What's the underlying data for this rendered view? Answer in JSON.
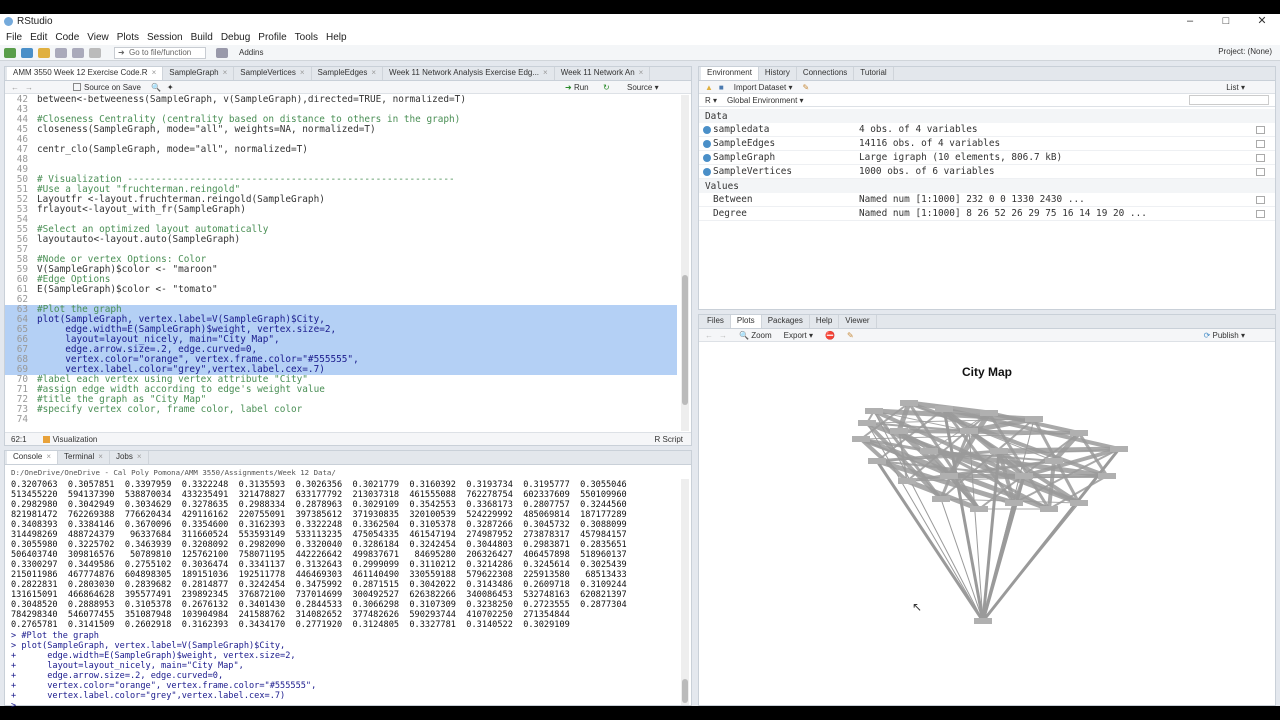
{
  "app": {
    "title": "RStudio"
  },
  "menu": [
    "File",
    "Edit",
    "Code",
    "View",
    "Plots",
    "Session",
    "Build",
    "Debug",
    "Profile",
    "Tools",
    "Help"
  ],
  "toolbar": {
    "go_to_file": "Go to file/function",
    "addins": "Addins",
    "project": "Project: (None)"
  },
  "editor": {
    "tabs": [
      "AMM 3550 Week 12 Exercise Code.R",
      "SampleGraph",
      "SampleVertices",
      "SampleEdges",
      "Week 11 Network Analysis Exercise Edg...",
      "Week 11 Network An"
    ],
    "source_on_save": "Source on Save",
    "run": "Run",
    "source": "Source",
    "lines": [
      {
        "n": "42",
        "t": "between<-betweeness(SampleGraph, v(SampleGraph),directed=TRUE, normalized=T)",
        "k": "c0"
      },
      {
        "n": "43",
        "t": "",
        "k": ""
      },
      {
        "n": "44",
        "t": "#Closeness Centrality (centrality based on distance to others in the graph)",
        "k": "c"
      },
      {
        "n": "45",
        "t": "closeness(SampleGraph, mode=\"all\", weights=NA, normalized=T)",
        "k": ""
      },
      {
        "n": "46",
        "t": "",
        "k": ""
      },
      {
        "n": "47",
        "t": "centr_clo(SampleGraph, mode=\"all\", normalized=T)",
        "k": ""
      },
      {
        "n": "48",
        "t": "",
        "k": ""
      },
      {
        "n": "49",
        "t": "",
        "k": ""
      },
      {
        "n": "50",
        "t": "# Visualization ----------------------------------------------------------",
        "k": "c"
      },
      {
        "n": "51",
        "t": "#Use a layout \"fruchterman.reingold\"",
        "k": "c"
      },
      {
        "n": "52",
        "t": "Layoutfr <-layout.fruchterman.reingold(SampleGraph)",
        "k": ""
      },
      {
        "n": "53",
        "t": "frlayout<-layout_with_fr(SampleGraph)",
        "k": ""
      },
      {
        "n": "54",
        "t": "",
        "k": ""
      },
      {
        "n": "55",
        "t": "#Select an optimized layout automatically",
        "k": "c"
      },
      {
        "n": "56",
        "t": "layoutauto<-layout.auto(SampleGraph)",
        "k": ""
      },
      {
        "n": "57",
        "t": "",
        "k": ""
      },
      {
        "n": "58",
        "t": "#Node or vertex Options: Color",
        "k": "c"
      },
      {
        "n": "59",
        "t": "V(SampleGraph)$color <- \"maroon\"",
        "k": ""
      },
      {
        "n": "60",
        "t": "#Edge Options",
        "k": "c"
      },
      {
        "n": "61",
        "t": "E(SampleGraph)$color <- \"tomato\"",
        "k": ""
      },
      {
        "n": "62",
        "t": "",
        "k": ""
      },
      {
        "n": "63",
        "t": "#Plot the graph",
        "k": "cs"
      },
      {
        "n": "64",
        "t": "plot(SampleGraph, vertex.label=V(SampleGraph)$City,",
        "k": "s"
      },
      {
        "n": "65",
        "t": "     edge.width=E(SampleGraph)$weight, vertex.size=2,",
        "k": "s"
      },
      {
        "n": "66",
        "t": "     layout=layout_nicely, main=\"City Map\",",
        "k": "s"
      },
      {
        "n": "67",
        "t": "     edge.arrow.size=.2, edge.curved=0,",
        "k": "s"
      },
      {
        "n": "68",
        "t": "     vertex.color=\"orange\", vertex.frame.color=\"#555555\",",
        "k": "s"
      },
      {
        "n": "69",
        "t": "     vertex.label.color=\"grey\",vertex.label.cex=.7)",
        "k": "s"
      },
      {
        "n": "70",
        "t": "#label each vertex using vertex attribute \"City\"",
        "k": "c"
      },
      {
        "n": "71",
        "t": "#assign edge width according to edge's weight value",
        "k": "c"
      },
      {
        "n": "72",
        "t": "#title the graph as \"City Map\"",
        "k": "c"
      },
      {
        "n": "73",
        "t": "#specify vertex color, frame color, label color",
        "k": "c"
      },
      {
        "n": "74",
        "t": "",
        "k": ""
      }
    ],
    "status_pos": "62:1",
    "status_section": "Visualization",
    "status_type": "R Script"
  },
  "env": {
    "tabs": [
      "Environment",
      "History",
      "Connections",
      "Tutorial"
    ],
    "import": "Import Dataset",
    "list": "List",
    "r": "R",
    "global": "Global Environment",
    "data_header": "Data",
    "values_header": "Values",
    "data": [
      {
        "name": "sampledata",
        "value": "4 obs. of 4 variables"
      },
      {
        "name": "SampleEdges",
        "value": "14116 obs. of 4 variables"
      },
      {
        "name": "SampleGraph",
        "value": "Large igraph (10 elements,  806.7 kB)"
      },
      {
        "name": "SampleVertices",
        "value": "1000 obs. of 6 variables"
      }
    ],
    "values": [
      {
        "name": "Between",
        "value": "Named num [1:1000] 232 0 0 1330 2430 ..."
      },
      {
        "name": "Degree",
        "value": "Named num [1:1000] 8 26 52 26 29 75 16 14 19 20 ..."
      }
    ]
  },
  "plots": {
    "tabs": [
      "Files",
      "Plots",
      "Packages",
      "Help",
      "Viewer"
    ],
    "zoom": "Zoom",
    "export": "Export",
    "publish": "Publish",
    "title": "City Map"
  },
  "console": {
    "tabs": [
      "Console",
      "Terminal",
      "Jobs"
    ],
    "path": "D:/OneDrive/OneDrive - Cal Poly Pomona/AMM 3550/Assignments/Week 12 Data/",
    "output": [
      "0.3207063  0.3057851  0.3397959  0.3322248  0.3135593  0.3026356  0.3021779  0.3160392  0.3193734  0.3195777  0.3055046",
      "513455220  594137390  538870034  433235491  321478827  633177792  213037318  461555088  762278754  602337609  550109960",
      "0.2982980  0.3042949  0.3034629  0.3278635  0.2988334  0.2878963  0.3029109  0.3542553  0.3368173  0.2807757  0.3244560",
      "821981472  762269388  776620434  429116162  220755091  397385612  371930835  320100539  524229992  485069814  187177289",
      "0.3408393  0.3384146  0.3670096  0.3354600  0.3162393  0.3322248  0.3362504  0.3105378  0.3287266  0.3045732  0.3088099",
      "314498269  488724379   96337684  311660524  553593149  533113235  475054335  461547194  274987952  273878317  457984157",
      "0.3055980  0.3225702  0.3463939  0.3208092  0.2982090  0.3320040  0.3286184  0.3242454  0.3044803  0.2983871  0.2835651",
      "506403740  309816576   50789810  125762100  758071195  442226642  499837671   84695280  206326427  406457898  518960137",
      "0.3300297  0.3449586  0.2755102  0.3036474  0.3341137  0.3132643  0.2999099  0.3110212  0.3214286  0.3245614  0.3025439",
      "215011986  467774876  604898305  189151036  192511778  446469303  461140490  330559188  579622308  225913580   68513433",
      "0.2822831  0.2803030  0.2839682  0.2814877  0.3242454  0.3475992  0.2871515  0.3042022  0.3143486  0.2609718  0.3109244",
      "131615091  466864628  395577491  239892345  376872100  737014699  300492527  626382266  340086453  532748163  620821397",
      "0.3048520  0.2888953  0.3105378  0.2676132  0.3401430  0.2844533  0.3066298  0.3107309  0.3238250  0.2723555  0.2877304",
      "784298340  546077455  351087948  103904984  241588762  314082652  377482626  590293744  410702250  271354844",
      "0.2765781  0.3141509  0.2602918  0.3162393  0.3434170  0.2771920  0.3124805  0.3327781  0.3140522  0.3029109"
    ],
    "cmd": [
      "> #Plot the graph",
      "> plot(SampleGraph, vertex.label=V(SampleGraph)$City,",
      "+      edge.width=E(SampleGraph)$weight, vertex.size=2,",
      "+      layout=layout_nicely, main=\"City Map\",",
      "+      edge.arrow.size=.2, edge.curved=0,",
      "+      vertex.color=\"orange\", vertex.frame.color=\"#555555\",",
      "+      vertex.label.color=\"grey\",vertex.label.cex=.7)",
      "> "
    ]
  }
}
